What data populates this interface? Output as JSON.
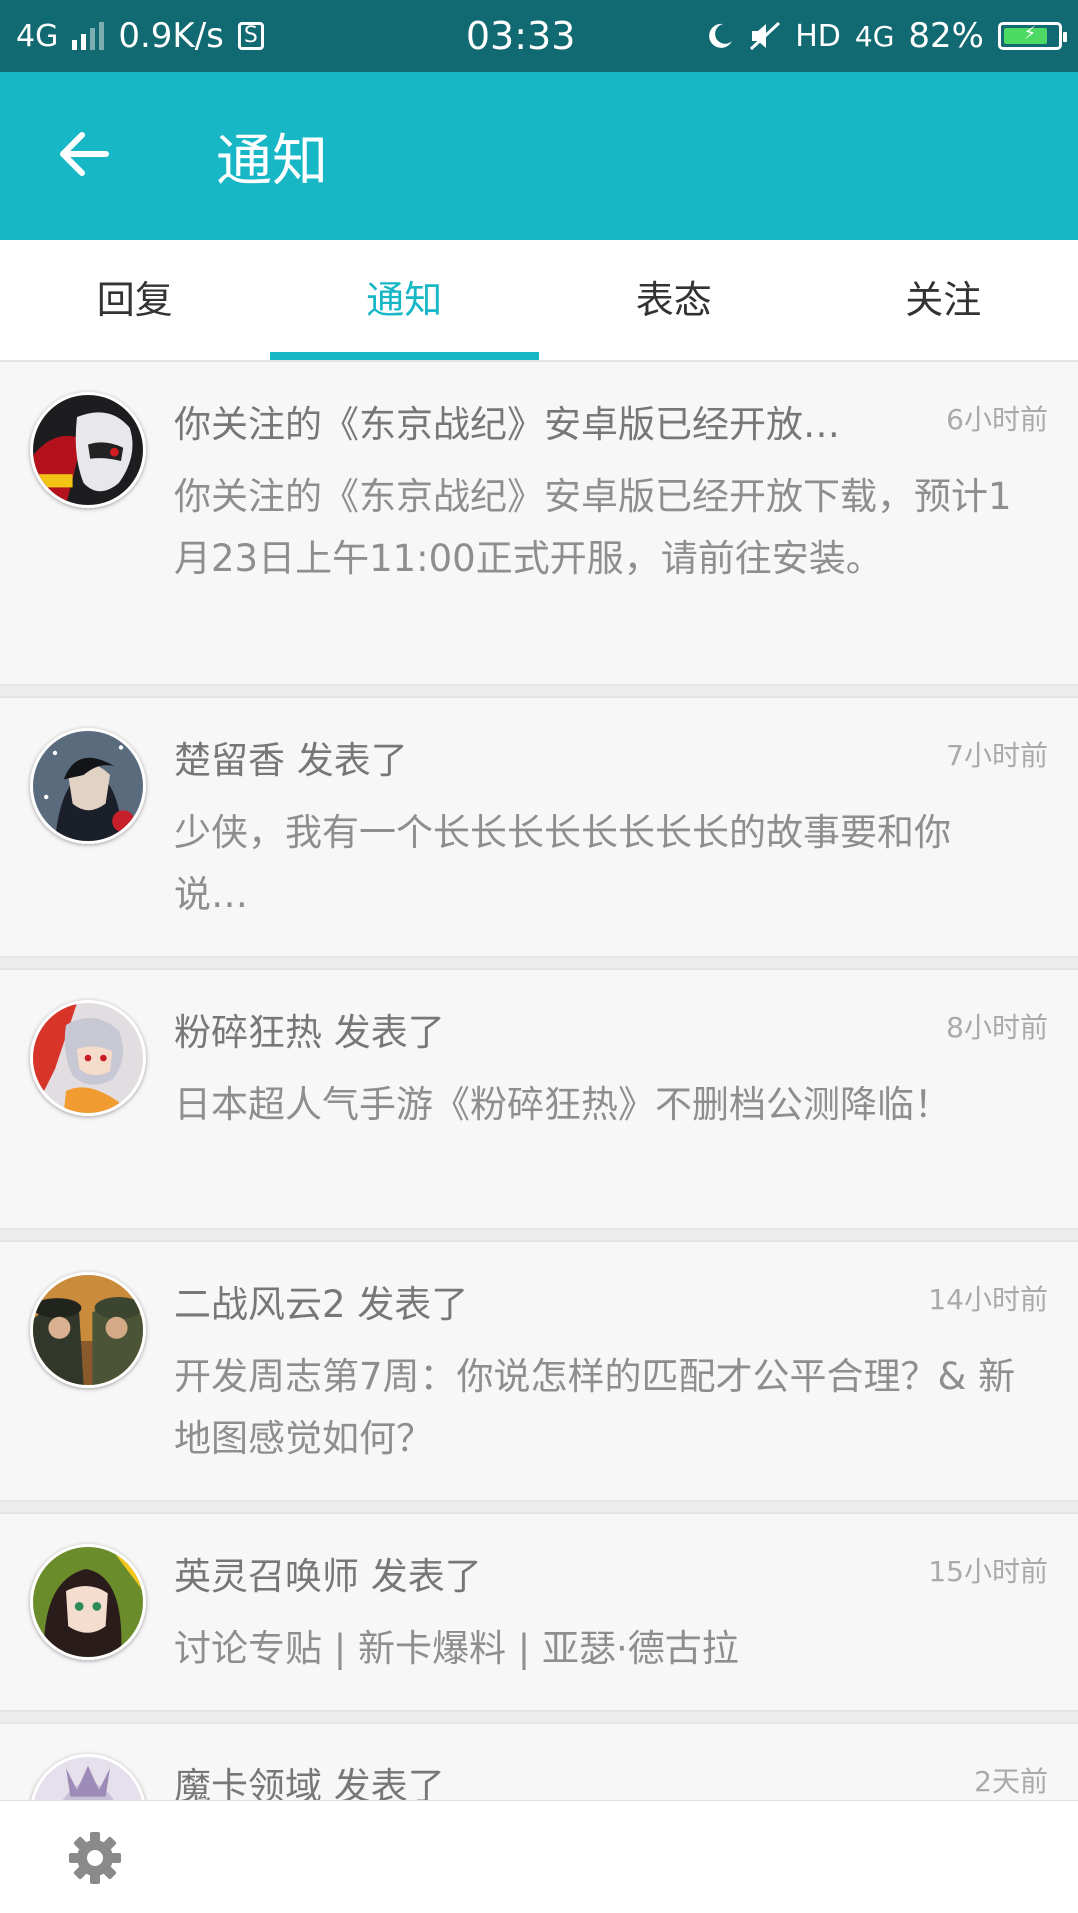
{
  "status_bar": {
    "network": "4G",
    "speed": "0.9K/s",
    "s_icon": "S",
    "time": "03:33",
    "hd": "HD",
    "net_right": "4G",
    "battery": "82%",
    "battery_level": 0.82,
    "battery_color": "#4cd964"
  },
  "app_bar": {
    "title": "通知",
    "back_icon": "arrow-left-icon",
    "color": "#17b7c6"
  },
  "tabs": [
    {
      "label": "回复",
      "active": false
    },
    {
      "label": "通知",
      "active": true
    },
    {
      "label": "表态",
      "active": false
    },
    {
      "label": "关注",
      "active": false
    }
  ],
  "notifications": [
    {
      "title": "你关注的《东京战纪》安卓版已经开放…",
      "time": "6小时前",
      "body": "你关注的《东京战纪》安卓版已经开放下载，预计1月23日上午11:00正式开服，请前往安装。"
    },
    {
      "title": "楚留香 发表了",
      "time": "7小时前",
      "body": "少侠，我有一个长长长长长长长长的故事要和你说…"
    },
    {
      "title": "粉碎狂热 发表了",
      "time": "8小时前",
      "body": "日本超人气手游《粉碎狂热》不删档公测降临！"
    },
    {
      "title": "二战风云2 发表了",
      "time": "14小时前",
      "body": "开发周志第7周：你说怎样的匹配才公平合理？& 新地图感觉如何？"
    },
    {
      "title": "英灵召唤师 发表了",
      "time": "15小时前",
      "body": "讨论专贴 | 新卡爆料 | 亚瑟·德古拉"
    },
    {
      "title": "魔卡领域 发表了",
      "time": "2天前",
      "body": ""
    }
  ],
  "bottom_bar": {
    "settings_icon": "gear-icon"
  }
}
